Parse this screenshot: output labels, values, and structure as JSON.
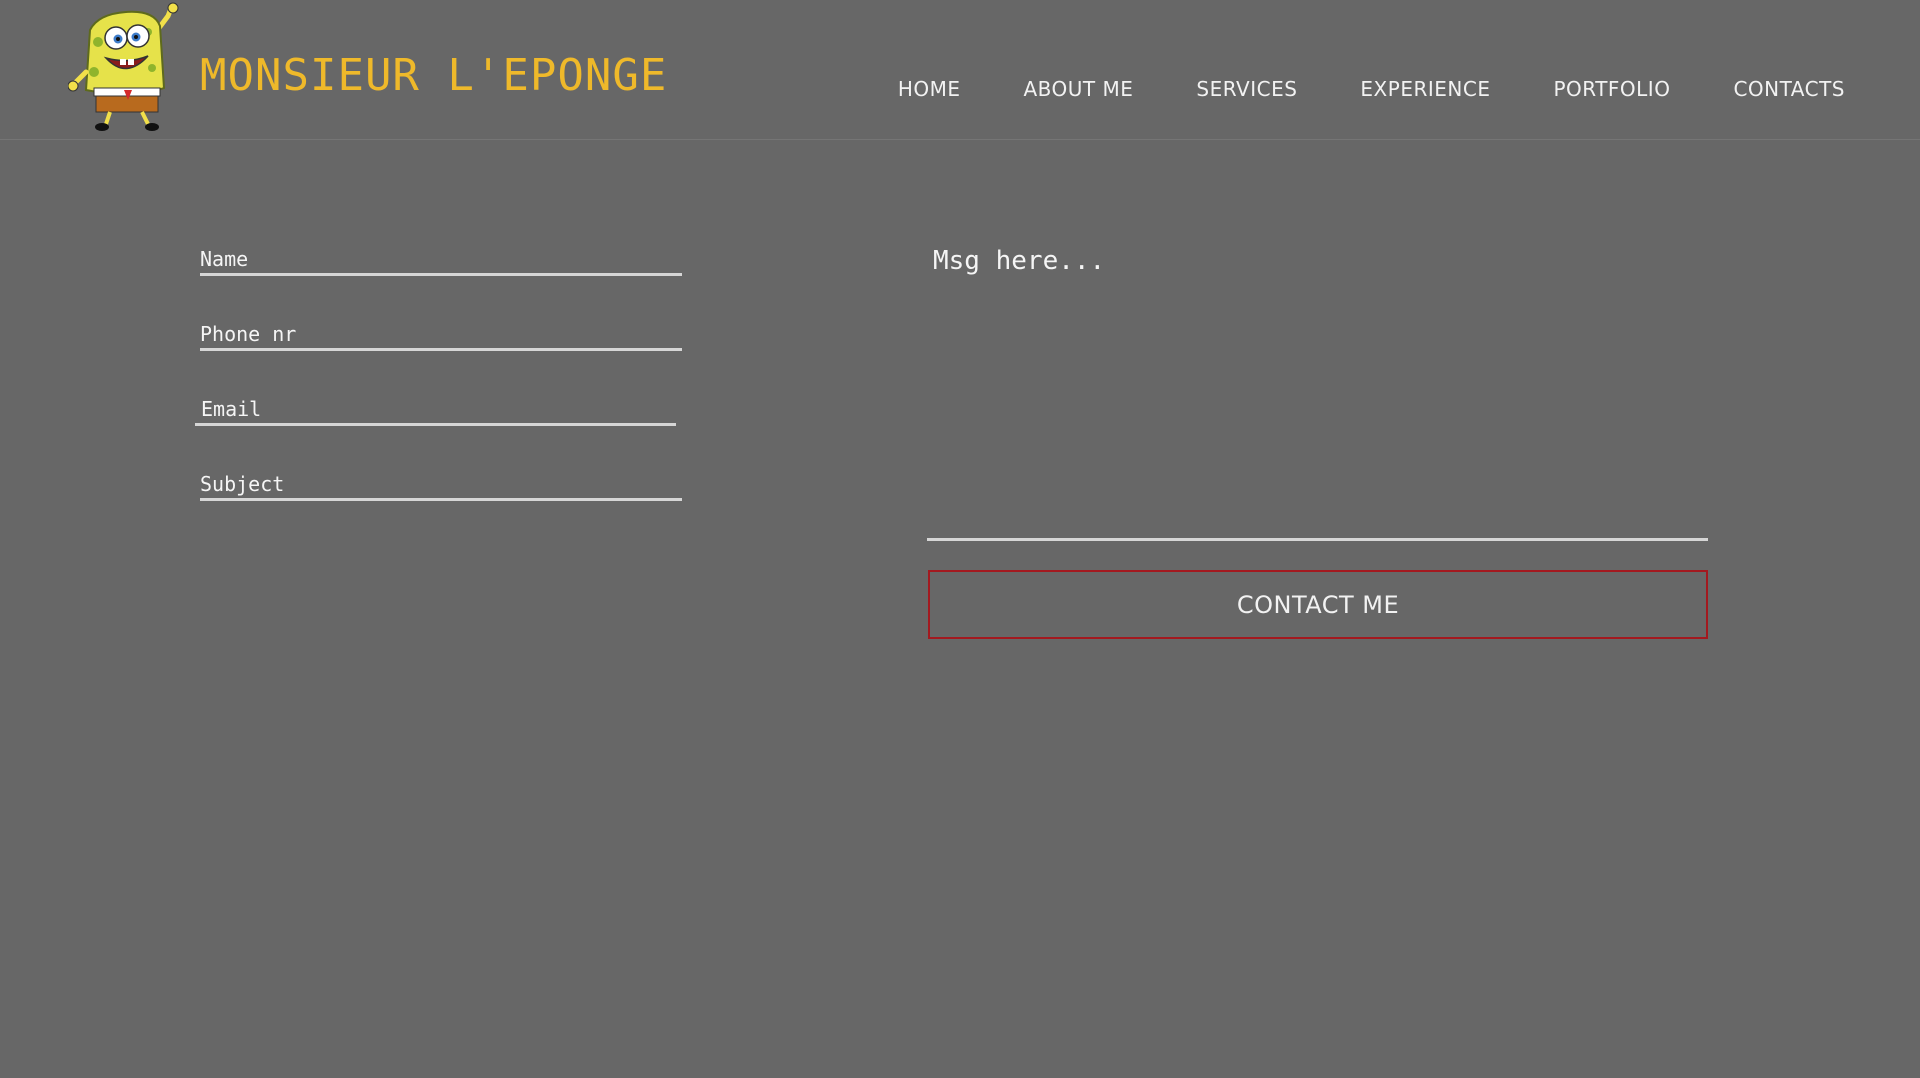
{
  "header": {
    "brand": "MONSIEUR L'EPONGE",
    "brand_color": "#efb92a",
    "logo_icon": "spongebob-logo-icon",
    "nav": [
      {
        "label": "HOME"
      },
      {
        "label": "ABOUT ME"
      },
      {
        "label": "SERVICES"
      },
      {
        "label": "EXPERIENCE"
      },
      {
        "label": "PORTFOLIO"
      },
      {
        "label": "CONTACTS"
      }
    ]
  },
  "form": {
    "name": {
      "placeholder": "Name",
      "value": ""
    },
    "phone": {
      "placeholder": "Phone nr",
      "value": ""
    },
    "email": {
      "placeholder": "Email",
      "value": ""
    },
    "subject": {
      "placeholder": "Subject",
      "value": ""
    },
    "message": {
      "placeholder": "Msg here...",
      "value": ""
    },
    "submit_label": "CONTACT ME",
    "submit_border_color": "#a3191f"
  },
  "colors": {
    "background": "#676767",
    "text": "#f2f2f2",
    "underline": "#d6d6d6"
  }
}
